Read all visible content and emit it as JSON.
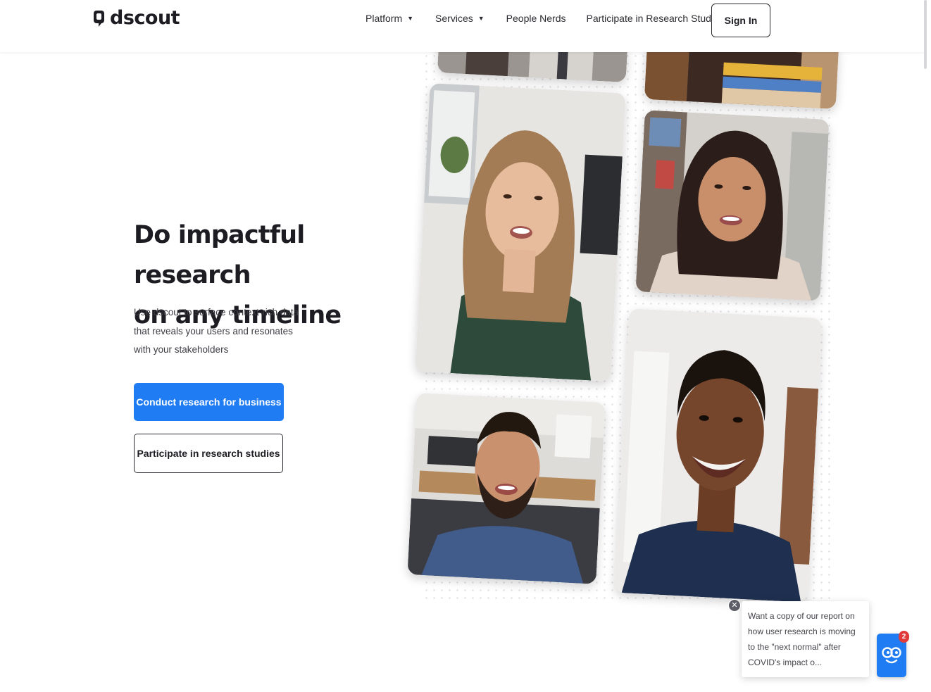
{
  "brand": {
    "name": "dscout",
    "logo_icon": "speech-bubble-logo-icon"
  },
  "nav": {
    "platform": "Platform",
    "services": "Services",
    "people_nerds": "People Nerds",
    "participate": "Participate in Research Studies",
    "caret_icon": "caret-down-icon",
    "sign_in": "Sign In"
  },
  "hero": {
    "title_line1": "Do impactful research",
    "title_line2": "on any timeline",
    "subtitle": "Use dscout to surface context-rich data that reveals your users and resonates with your stakeholders",
    "primary_button": "Conduct research for business",
    "secondary_button": "Participate in research studies"
  },
  "popup": {
    "message": "Want a copy of our report on how user research is moving to the \"next normal\" after COVID's impact o...",
    "close_icon": "close-icon",
    "chat_icon": "mascot-face-icon",
    "badge_count": "2"
  },
  "colors": {
    "accent": "#1f7cf2",
    "text": "#1c1c22",
    "badge": "#e13a3a"
  }
}
